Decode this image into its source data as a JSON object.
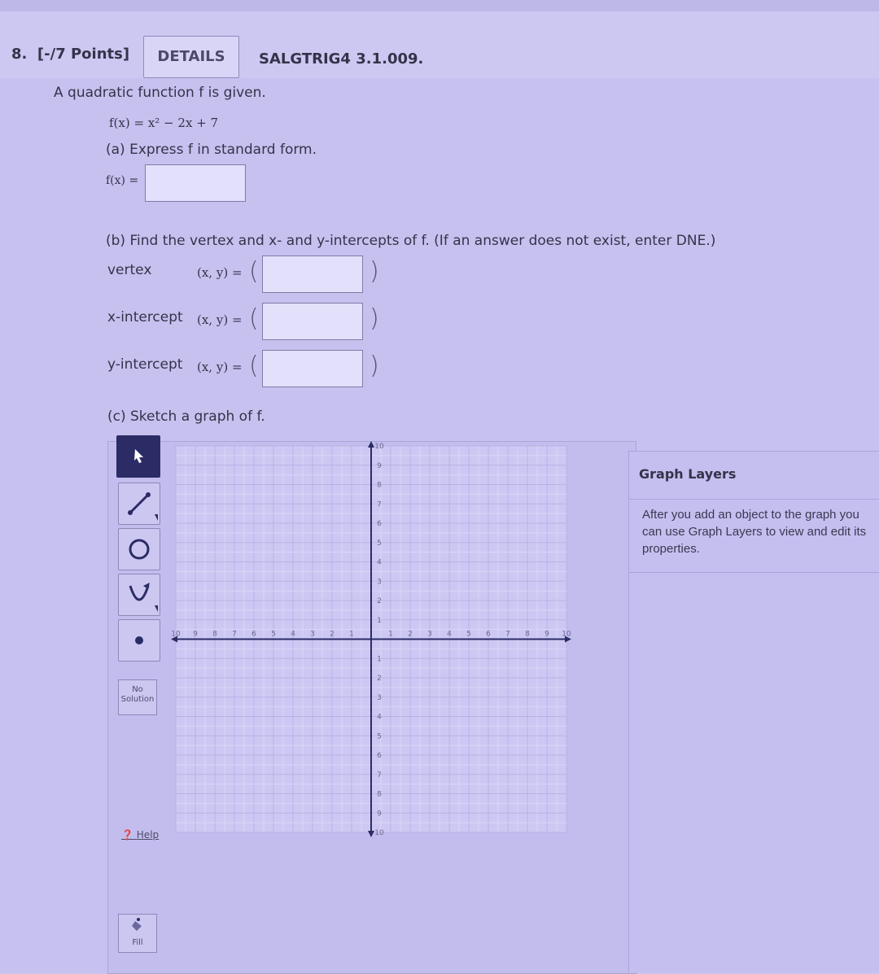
{
  "header": {
    "question_number": "8.",
    "points": "[-/7 Points]",
    "details_label": "DETAILS",
    "code": "SALGTRIG4 3.1.009."
  },
  "problem": {
    "intro": "A quadratic function f is given.",
    "function": "f(x) = x² − 2x + 7",
    "part_a": "(a) Express f in standard form.",
    "part_a_label": "f(x) =",
    "part_b": "(b) Find the vertex and x- and y-intercepts of f. (If an answer does not exist, enter DNE.)",
    "rows": [
      {
        "label": "vertex",
        "coords": "(x, y) =",
        "open": "(",
        "close": ")"
      },
      {
        "label": "x-intercept",
        "coords": "(x, y) =",
        "open": "(",
        "close": ")"
      },
      {
        "label": "y-intercept",
        "coords": "(x, y) =",
        "open": "(",
        "close": ")"
      }
    ],
    "part_c": "(c) Sketch a graph of f."
  },
  "graph_tools": {
    "items": [
      "pointer-tool",
      "line-tool",
      "circle-tool",
      "parabola-tool",
      "point-tool"
    ],
    "no_solution_1": "No",
    "no_solution_2": "Solution",
    "help": "Help",
    "fill": "Fill"
  },
  "graph": {
    "x_min": -10,
    "x_max": 10,
    "y_min": -10,
    "y_max": 10,
    "x_ticks_neg": [
      "10",
      "9",
      "8",
      "7",
      "6",
      "5",
      "4",
      "3",
      "2",
      "1"
    ],
    "x_ticks_pos": [
      "1",
      "2",
      "3",
      "4",
      "5",
      "6",
      "7",
      "8",
      "9",
      "10"
    ],
    "y_ticks_pos": [
      "10",
      "9",
      "8",
      "7",
      "6",
      "5",
      "4",
      "3",
      "2",
      "1"
    ],
    "y_ticks_neg": [
      "1",
      "2",
      "3",
      "4",
      "5",
      "6",
      "7",
      "8",
      "9",
      "10"
    ],
    "grid": true
  },
  "layers": {
    "title": "Graph Layers",
    "info": "After you add an object to the graph you can use Graph Layers to view and edit its properties."
  },
  "colors": {
    "accent": "#2b2c66",
    "background": "#c6c1ef"
  }
}
